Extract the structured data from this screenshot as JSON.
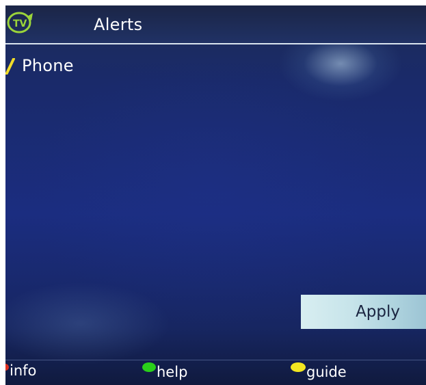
{
  "header": {
    "title": "Alerts",
    "logo_icon": "tv-logo-icon",
    "logo_text": "TV"
  },
  "list": {
    "items": [
      {
        "label": "Phone",
        "checked": true,
        "check_color": "#f0dc2a"
      }
    ]
  },
  "actions": {
    "apply_label": "Apply"
  },
  "footer": {
    "keys": [
      {
        "label": "info",
        "color": "#e0301e"
      },
      {
        "label": "help",
        "color": "#2ad01a"
      },
      {
        "label": "guide",
        "color": "#f2e620"
      }
    ]
  },
  "colors": {
    "background": "#1b2d80",
    "header_rule": "#d9e4ef",
    "logo": "#9bd43a",
    "button_bg": "#c7e4ea"
  }
}
